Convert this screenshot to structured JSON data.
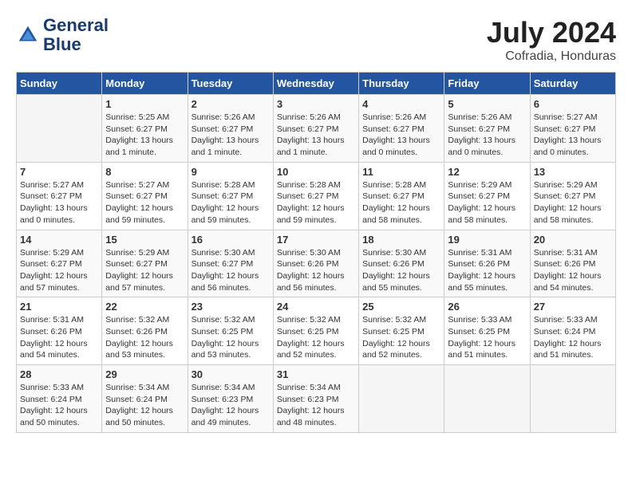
{
  "header": {
    "logo_line1": "General",
    "logo_line2": "Blue",
    "month_title": "July 2024",
    "location": "Cofradia, Honduras"
  },
  "weekdays": [
    "Sunday",
    "Monday",
    "Tuesday",
    "Wednesday",
    "Thursday",
    "Friday",
    "Saturday"
  ],
  "weeks": [
    [
      {
        "day": "",
        "info": ""
      },
      {
        "day": "1",
        "info": "Sunrise: 5:25 AM\nSunset: 6:27 PM\nDaylight: 13 hours\nand 1 minute."
      },
      {
        "day": "2",
        "info": "Sunrise: 5:26 AM\nSunset: 6:27 PM\nDaylight: 13 hours\nand 1 minute."
      },
      {
        "day": "3",
        "info": "Sunrise: 5:26 AM\nSunset: 6:27 PM\nDaylight: 13 hours\nand 1 minute."
      },
      {
        "day": "4",
        "info": "Sunrise: 5:26 AM\nSunset: 6:27 PM\nDaylight: 13 hours\nand 0 minutes."
      },
      {
        "day": "5",
        "info": "Sunrise: 5:26 AM\nSunset: 6:27 PM\nDaylight: 13 hours\nand 0 minutes."
      },
      {
        "day": "6",
        "info": "Sunrise: 5:27 AM\nSunset: 6:27 PM\nDaylight: 13 hours\nand 0 minutes."
      }
    ],
    [
      {
        "day": "7",
        "info": "Sunrise: 5:27 AM\nSunset: 6:27 PM\nDaylight: 13 hours\nand 0 minutes."
      },
      {
        "day": "8",
        "info": "Sunrise: 5:27 AM\nSunset: 6:27 PM\nDaylight: 12 hours\nand 59 minutes."
      },
      {
        "day": "9",
        "info": "Sunrise: 5:28 AM\nSunset: 6:27 PM\nDaylight: 12 hours\nand 59 minutes."
      },
      {
        "day": "10",
        "info": "Sunrise: 5:28 AM\nSunset: 6:27 PM\nDaylight: 12 hours\nand 59 minutes."
      },
      {
        "day": "11",
        "info": "Sunrise: 5:28 AM\nSunset: 6:27 PM\nDaylight: 12 hours\nand 58 minutes."
      },
      {
        "day": "12",
        "info": "Sunrise: 5:29 AM\nSunset: 6:27 PM\nDaylight: 12 hours\nand 58 minutes."
      },
      {
        "day": "13",
        "info": "Sunrise: 5:29 AM\nSunset: 6:27 PM\nDaylight: 12 hours\nand 58 minutes."
      }
    ],
    [
      {
        "day": "14",
        "info": "Sunrise: 5:29 AM\nSunset: 6:27 PM\nDaylight: 12 hours\nand 57 minutes."
      },
      {
        "day": "15",
        "info": "Sunrise: 5:29 AM\nSunset: 6:27 PM\nDaylight: 12 hours\nand 57 minutes."
      },
      {
        "day": "16",
        "info": "Sunrise: 5:30 AM\nSunset: 6:27 PM\nDaylight: 12 hours\nand 56 minutes."
      },
      {
        "day": "17",
        "info": "Sunrise: 5:30 AM\nSunset: 6:26 PM\nDaylight: 12 hours\nand 56 minutes."
      },
      {
        "day": "18",
        "info": "Sunrise: 5:30 AM\nSunset: 6:26 PM\nDaylight: 12 hours\nand 55 minutes."
      },
      {
        "day": "19",
        "info": "Sunrise: 5:31 AM\nSunset: 6:26 PM\nDaylight: 12 hours\nand 55 minutes."
      },
      {
        "day": "20",
        "info": "Sunrise: 5:31 AM\nSunset: 6:26 PM\nDaylight: 12 hours\nand 54 minutes."
      }
    ],
    [
      {
        "day": "21",
        "info": "Sunrise: 5:31 AM\nSunset: 6:26 PM\nDaylight: 12 hours\nand 54 minutes."
      },
      {
        "day": "22",
        "info": "Sunrise: 5:32 AM\nSunset: 6:26 PM\nDaylight: 12 hours\nand 53 minutes."
      },
      {
        "day": "23",
        "info": "Sunrise: 5:32 AM\nSunset: 6:25 PM\nDaylight: 12 hours\nand 53 minutes."
      },
      {
        "day": "24",
        "info": "Sunrise: 5:32 AM\nSunset: 6:25 PM\nDaylight: 12 hours\nand 52 minutes."
      },
      {
        "day": "25",
        "info": "Sunrise: 5:32 AM\nSunset: 6:25 PM\nDaylight: 12 hours\nand 52 minutes."
      },
      {
        "day": "26",
        "info": "Sunrise: 5:33 AM\nSunset: 6:25 PM\nDaylight: 12 hours\nand 51 minutes."
      },
      {
        "day": "27",
        "info": "Sunrise: 5:33 AM\nSunset: 6:24 PM\nDaylight: 12 hours\nand 51 minutes."
      }
    ],
    [
      {
        "day": "28",
        "info": "Sunrise: 5:33 AM\nSunset: 6:24 PM\nDaylight: 12 hours\nand 50 minutes."
      },
      {
        "day": "29",
        "info": "Sunrise: 5:34 AM\nSunset: 6:24 PM\nDaylight: 12 hours\nand 50 minutes."
      },
      {
        "day": "30",
        "info": "Sunrise: 5:34 AM\nSunset: 6:23 PM\nDaylight: 12 hours\nand 49 minutes."
      },
      {
        "day": "31",
        "info": "Sunrise: 5:34 AM\nSunset: 6:23 PM\nDaylight: 12 hours\nand 48 minutes."
      },
      {
        "day": "",
        "info": ""
      },
      {
        "day": "",
        "info": ""
      },
      {
        "day": "",
        "info": ""
      }
    ]
  ]
}
